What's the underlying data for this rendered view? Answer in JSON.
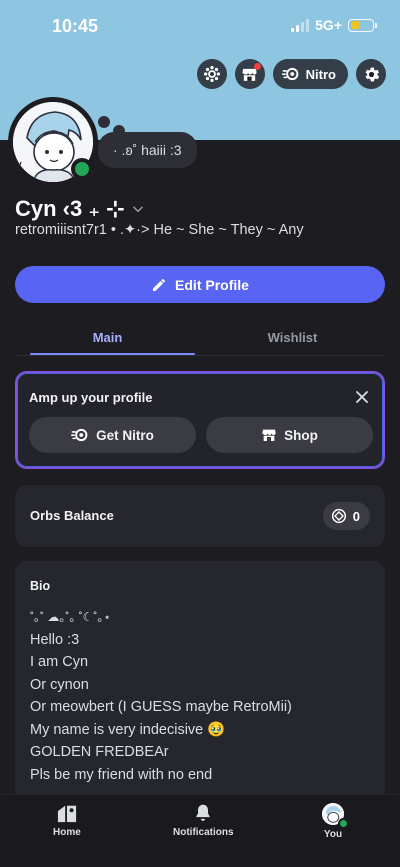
{
  "status_bar": {
    "time": "10:45",
    "network": "5G+",
    "battery_color": "#f0c419"
  },
  "header": {
    "nitro_label": "Nitro",
    "icons": [
      "flower-decoration-icon",
      "shop-icon",
      "nitro-icon",
      "settings-gear-icon"
    ],
    "banner_color": "#8ec5e0"
  },
  "profile": {
    "status_text": "· .ʚ˚ haiii :3",
    "display_name": "Cyn ‹3 ₊ ⊹",
    "username_line": "retromiiisnt7r1 • .✦·> He ~ She ~ They ~ Any",
    "online": true
  },
  "actions": {
    "edit_profile_label": "Edit Profile"
  },
  "tabs": [
    {
      "label": "Main",
      "active": true
    },
    {
      "label": "Wishlist",
      "active": false
    }
  ],
  "amp_card": {
    "title": "Amp up your profile",
    "get_nitro_label": "Get Nitro",
    "shop_label": "Shop"
  },
  "orbs": {
    "label": "Orbs Balance",
    "value": "0"
  },
  "bio": {
    "title": "Bio",
    "lines": [
      "˚｡˚ ☁｡˚｡ ˚☾˚｡⋆",
      "Hello :3",
      "I am Cyn",
      "Or cynon",
      "Or meowbert (I GUESS maybe RetroMii)",
      "My name is very indecisive 🥹",
      "GOLDEN FREDBEAr",
      "Pls be my friend with no end"
    ]
  },
  "bottom_nav": [
    {
      "label": "Home",
      "icon": "home-icon"
    },
    {
      "label": "Notifications",
      "icon": "bell-icon"
    },
    {
      "label": "You",
      "icon": "avatar"
    }
  ],
  "colors": {
    "accent": "#5865f2",
    "online": "#23a55a",
    "background": "#1c1c21"
  }
}
